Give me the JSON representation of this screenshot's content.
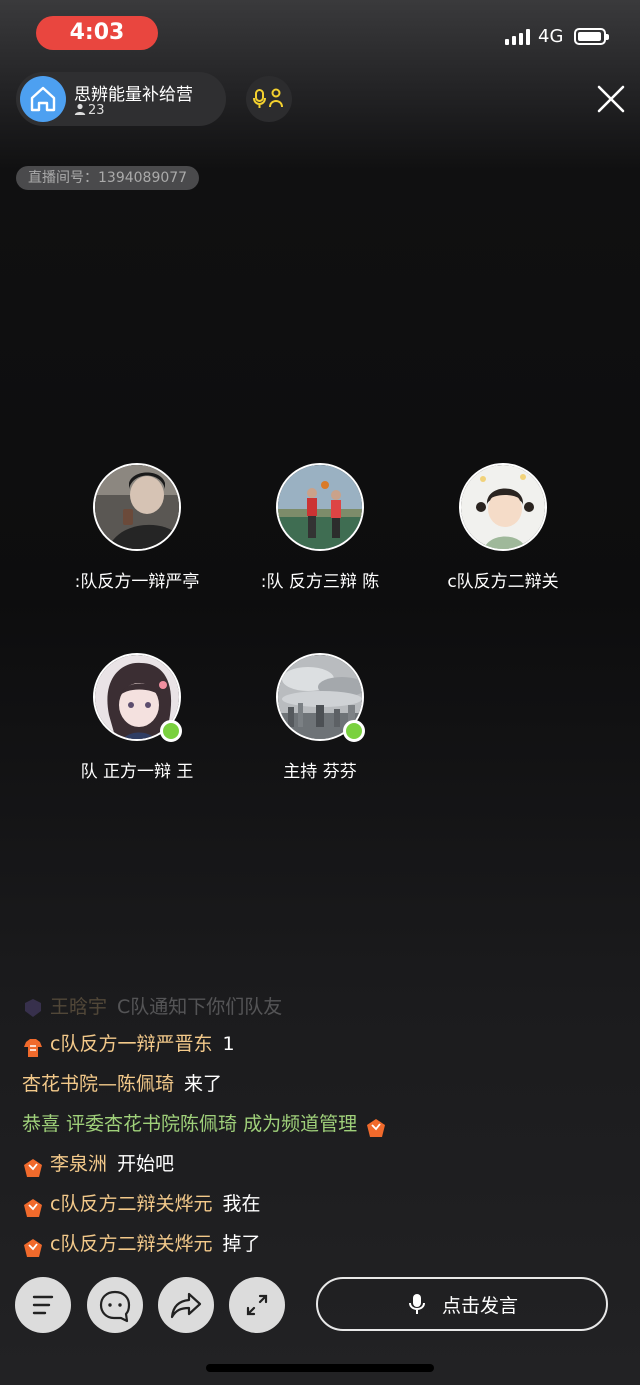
{
  "status": {
    "time": "4:03",
    "network": "4G"
  },
  "room": {
    "name": "思辨能量补给营",
    "count": "23",
    "id_label": "直播间号：1394089077"
  },
  "seats": [
    {
      "name": ":队反方一辩严亭",
      "online": false
    },
    {
      "name": ":队 反方三辩 陈",
      "online": false
    },
    {
      "name": "c队反方二辩关",
      "online": false
    },
    {
      "name": "队 正方一辩 王",
      "online": true
    },
    {
      "name": "主持 芬芬",
      "online": true
    }
  ],
  "chat": [
    {
      "user": "王晗宇",
      "text": "C队通知下你们队友",
      "faded": true
    },
    {
      "user": "c队反方一辩严晋东",
      "text": "1"
    },
    {
      "user": "杏花书院—陈佩琦",
      "text": "来了"
    },
    {
      "system": "恭喜 评委杏花书院陈佩琦 成为频道管理"
    },
    {
      "user": "李泉洲",
      "text": "开始吧"
    },
    {
      "user": "c队反方二辩关烨元",
      "text": "我在"
    },
    {
      "user": "c队反方二辩关烨元",
      "text": "掉了"
    }
  ],
  "bottom": {
    "speak_label": "点击发言"
  },
  "colors": {
    "accent_red": "#e9463f",
    "online_green": "#7ad13f",
    "home_blue": "#4da0f1",
    "badge_orange": "#f06a2c"
  }
}
